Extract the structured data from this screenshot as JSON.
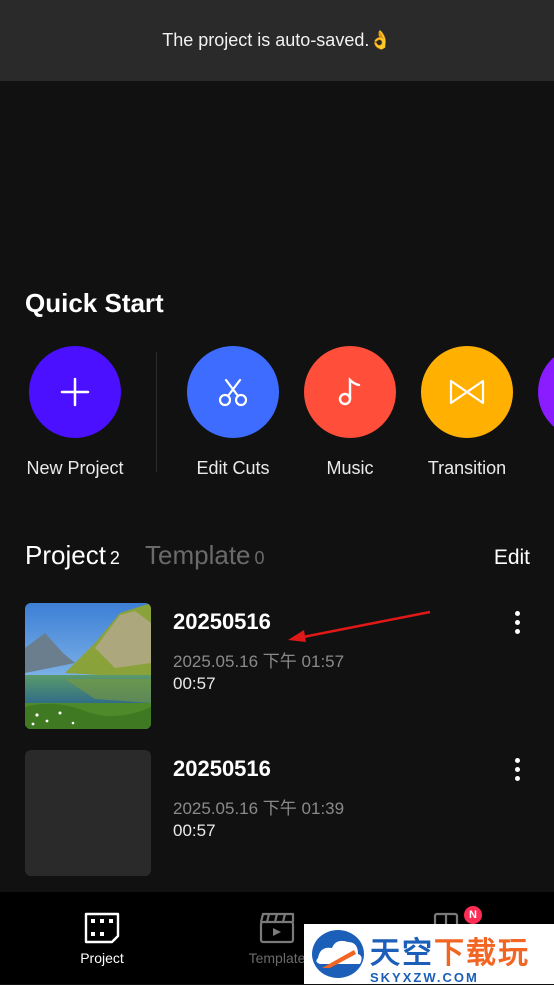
{
  "toast": {
    "text": "The project is auto-saved.👌"
  },
  "quick_start": {
    "title": "Quick Start",
    "items": [
      {
        "label": "New Project",
        "color": "#4a10ff",
        "icon": "plus-icon"
      },
      {
        "label": "Edit Cuts",
        "color": "#3d6cff",
        "icon": "scissors-icon"
      },
      {
        "label": "Music",
        "color": "#ff4e3a",
        "icon": "music-note-icon"
      },
      {
        "label": "Transition",
        "color": "#ffb000",
        "icon": "bowtie-transition-icon"
      },
      {
        "label": "",
        "color": "#8a1cff",
        "icon": "partial-icon"
      }
    ]
  },
  "tabs": {
    "project_label": "Project",
    "project_count": "2",
    "template_label": "Template",
    "template_count": "0",
    "edit_label": "Edit"
  },
  "projects": [
    {
      "name": "20250516",
      "date": "2025.05.16 下午 01:57",
      "duration": "00:57",
      "thumbnail": "mountain-lake-landscape"
    },
    {
      "name": "20250516",
      "date": "2025.05.16 下午 01:39",
      "duration": "00:57",
      "thumbnail": "blank"
    }
  ],
  "bottom_nav": {
    "items": [
      {
        "label": "Project",
        "icon": "film-frame-icon",
        "active": true
      },
      {
        "label": "Template",
        "icon": "clapperboard-icon",
        "active": false
      },
      {
        "label": "",
        "icon": "grid-icon",
        "active": false,
        "badge": "N"
      }
    ]
  },
  "watermark": {
    "cn_1": "天空",
    "cn_2": "下载玩",
    "en": "SKYXZW.COM"
  }
}
